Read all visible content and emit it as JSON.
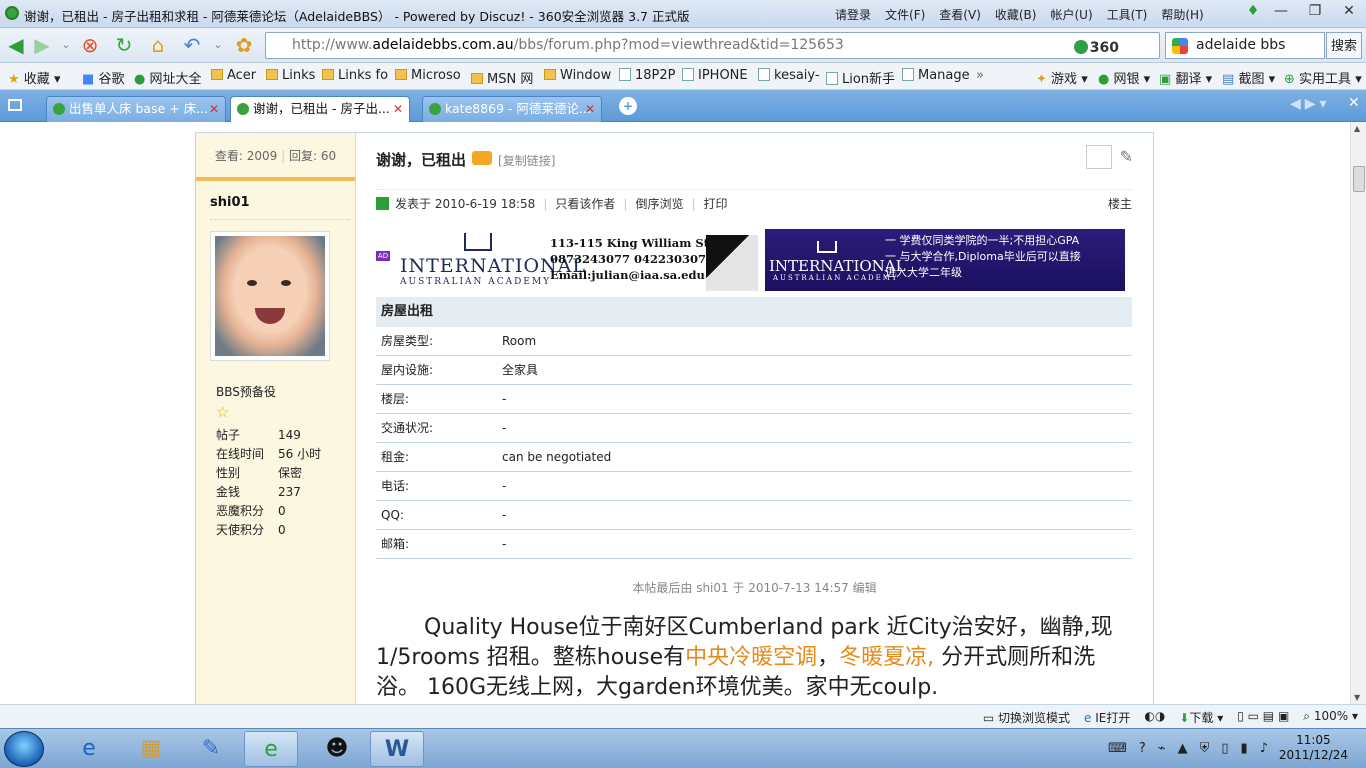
{
  "window": {
    "title": "谢谢，已租出 - 房子出租和求租 - 阿德莱德论坛（AdelaideBBS） - Powered by Discuz! - 360安全浏览器 3.7 正式版",
    "menu": [
      "请登录",
      "文件(F)",
      "查看(V)",
      "收藏(B)",
      "帐户(U)",
      "工具(T)",
      "帮助(H)"
    ]
  },
  "address": {
    "prefix": "http://www.",
    "domain": "adelaidebbs.com.au",
    "path": "/bbs/forum.php?mod=viewthread&tid=125653",
    "badge": "360",
    "search_value": "adelaide bbs",
    "search_button": "搜索"
  },
  "bookmarks": [
    {
      "label": "收藏",
      "icon": "star-icon"
    },
    {
      "label": "谷歌",
      "icon": "google-icon"
    },
    {
      "label": "网址大全",
      "icon": "globe-icon"
    },
    {
      "label": "Acer",
      "icon": "folder-icon"
    },
    {
      "label": "Links",
      "icon": "folder-icon"
    },
    {
      "label": "Links fo",
      "icon": "folder-icon"
    },
    {
      "label": "Microso",
      "icon": "folder-icon"
    },
    {
      "label": "MSN 网",
      "icon": "folder-icon"
    },
    {
      "label": "Window",
      "icon": "folder-icon"
    },
    {
      "label": "18P2P",
      "icon": "page-icon"
    },
    {
      "label": "IPHONE",
      "icon": "page-icon"
    },
    {
      "label": "kesaiy-",
      "icon": "page-icon"
    },
    {
      "label": "Lion新手",
      "icon": "page-icon"
    },
    {
      "label": "Manage",
      "icon": "page-icon"
    }
  ],
  "bookmarks_right": [
    "游戏",
    "网银",
    "翻译",
    "截图",
    "实用工具"
  ],
  "tabs": [
    {
      "label": "出售单人床 base + 床...",
      "active": false
    },
    {
      "label": "谢谢，已租出 - 房子出...",
      "active": true
    },
    {
      "label": "kate8869 - 阿德莱德论...",
      "active": false
    }
  ],
  "post": {
    "views_label": "查看: 2009",
    "replies_label": "回复: 60",
    "username": "shi01",
    "group": "BBS预备役",
    "profile": [
      {
        "k": "帖子",
        "v": "149"
      },
      {
        "k": "在线时间",
        "v": "56 小时"
      },
      {
        "k": "性别",
        "v": "保密"
      },
      {
        "k": "金钱",
        "v": "237"
      },
      {
        "k": "恶魔积分",
        "v": "0"
      },
      {
        "k": "天使积分",
        "v": "0"
      }
    ],
    "title": "谢谢，已租出",
    "copy_link": "[复制链接]",
    "posted": "发表于  2010-6-19 18:58",
    "only_author": "只看该作者",
    "reverse": "倒序浏览",
    "print": "打印",
    "floor": "楼主",
    "edited": "本帖最后由 shi01 于 2010-7-13 14:57 编辑"
  },
  "ads": {
    "ad_badge": "AD",
    "org": "INTERNATIONAL",
    "org_sub": "AUSTRALIAN  ACADEMY",
    "address": "113-115 King William St",
    "phones": "0873243077  0422303070",
    "email": "Email:julian@iaa.sa.edu.au",
    "right_lines": [
      "一 学费仅同类学院的一半;不用担心GPA",
      "一 与大学合作,Diploma毕业后可以直接",
      "进入大学二年级"
    ]
  },
  "listing": {
    "header": "房屋出租",
    "rows": [
      {
        "k": "房屋类型:",
        "v": "Room"
      },
      {
        "k": "屋内设施:",
        "v": "全家具"
      },
      {
        "k": "楼层:",
        "v": "-"
      },
      {
        "k": "交通状况:",
        "v": "-"
      },
      {
        "k": "租金:",
        "v": "can be negotiated"
      },
      {
        "k": "电话:",
        "v": "-"
      },
      {
        "k": "QQ:",
        "v": "-"
      },
      {
        "k": "邮箱:",
        "v": "-"
      }
    ]
  },
  "body": {
    "p1": "Quality House位于南好区Cumberland park 近City治安好，幽静,现1/5rooms 招租。整栋house有",
    "hl1": "中央冷暖空调",
    "sep": "，",
    "hl2": "冬暖夏凉,",
    "p2": " 分开式厕所和洗浴。 160G无线上网，大garden环境优美。家中无coulp."
  },
  "status": [
    "切换浏览模式",
    "IE打开",
    "下载",
    "100%"
  ],
  "clock": {
    "time": "11:05",
    "date": "2011/12/24"
  },
  "colors": {
    "accent_orange": "#e68a1a",
    "tab_blue": "#6aa3dd",
    "sidebar_bg": "#fbf7e1"
  }
}
